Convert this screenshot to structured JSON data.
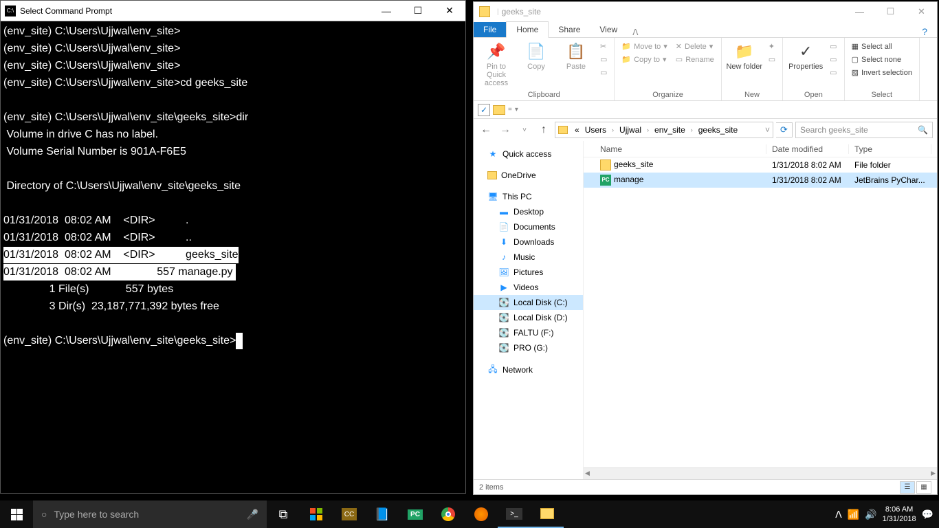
{
  "cmd": {
    "title": "Select Command Prompt",
    "lines": [
      "(env_site) C:\\Users\\Ujjwal\\env_site>",
      "(env_site) C:\\Users\\Ujjwal\\env_site>",
      "(env_site) C:\\Users\\Ujjwal\\env_site>",
      "(env_site) C:\\Users\\Ujjwal\\env_site>cd geeks_site",
      "",
      "(env_site) C:\\Users\\Ujjwal\\env_site\\geeks_site>dir",
      " Volume in drive C has no label.",
      " Volume Serial Number is 901A-F6E5",
      "",
      " Directory of C:\\Users\\Ujjwal\\env_site\\geeks_site",
      "",
      "01/31/2018  08:02 AM    <DIR>          .",
      "01/31/2018  08:02 AM    <DIR>          ..",
      "01/31/2018  08:02 AM    <DIR>          geeks_site",
      "01/31/2018  08:02 AM               557 manage.py ",
      "               1 File(s)            557 bytes",
      "               3 Dir(s)  23,187,771,392 bytes free",
      "",
      "(env_site) C:\\Users\\Ujjwal\\env_site\\geeks_site>"
    ]
  },
  "explorer": {
    "title": "geeks_site",
    "tabs": {
      "file": "File",
      "home": "Home",
      "share": "Share",
      "view": "View"
    },
    "ribbon": {
      "pin": "Pin to Quick access",
      "copy": "Copy",
      "paste": "Paste",
      "moveto": "Move to",
      "copyto": "Copy to",
      "delete": "Delete",
      "rename": "Rename",
      "newfolder": "New folder",
      "properties": "Properties",
      "selectall": "Select all",
      "selectnone": "Select none",
      "invert": "Invert selection",
      "groups": {
        "clipboard": "Clipboard",
        "organize": "Organize",
        "new": "New",
        "open": "Open",
        "select": "Select"
      }
    },
    "breadcrumbs": [
      "Users",
      "Ujjwal",
      "env_site",
      "geeks_site"
    ],
    "search_placeholder": "Search geeks_site",
    "nav": {
      "quick": "Quick access",
      "onedrive": "OneDrive",
      "thispc": "This PC",
      "desktop": "Desktop",
      "documents": "Documents",
      "downloads": "Downloads",
      "music": "Music",
      "pictures": "Pictures",
      "videos": "Videos",
      "localc": "Local Disk (C:)",
      "locald": "Local Disk (D:)",
      "faltu": "FALTU (F:)",
      "pro": "PRO (G:)",
      "network": "Network"
    },
    "headers": {
      "name": "Name",
      "date": "Date modified",
      "type": "Type"
    },
    "files": [
      {
        "name": "geeks_site",
        "date": "1/31/2018 8:02 AM",
        "type": "File folder",
        "icon": "folder"
      },
      {
        "name": "manage",
        "date": "1/31/2018 8:02 AM",
        "type": "JetBrains PyChar...",
        "icon": "pc"
      }
    ],
    "status": "2 items"
  },
  "taskbar": {
    "search": "Type here to search",
    "time": "8:06 AM",
    "date": "1/31/2018"
  }
}
